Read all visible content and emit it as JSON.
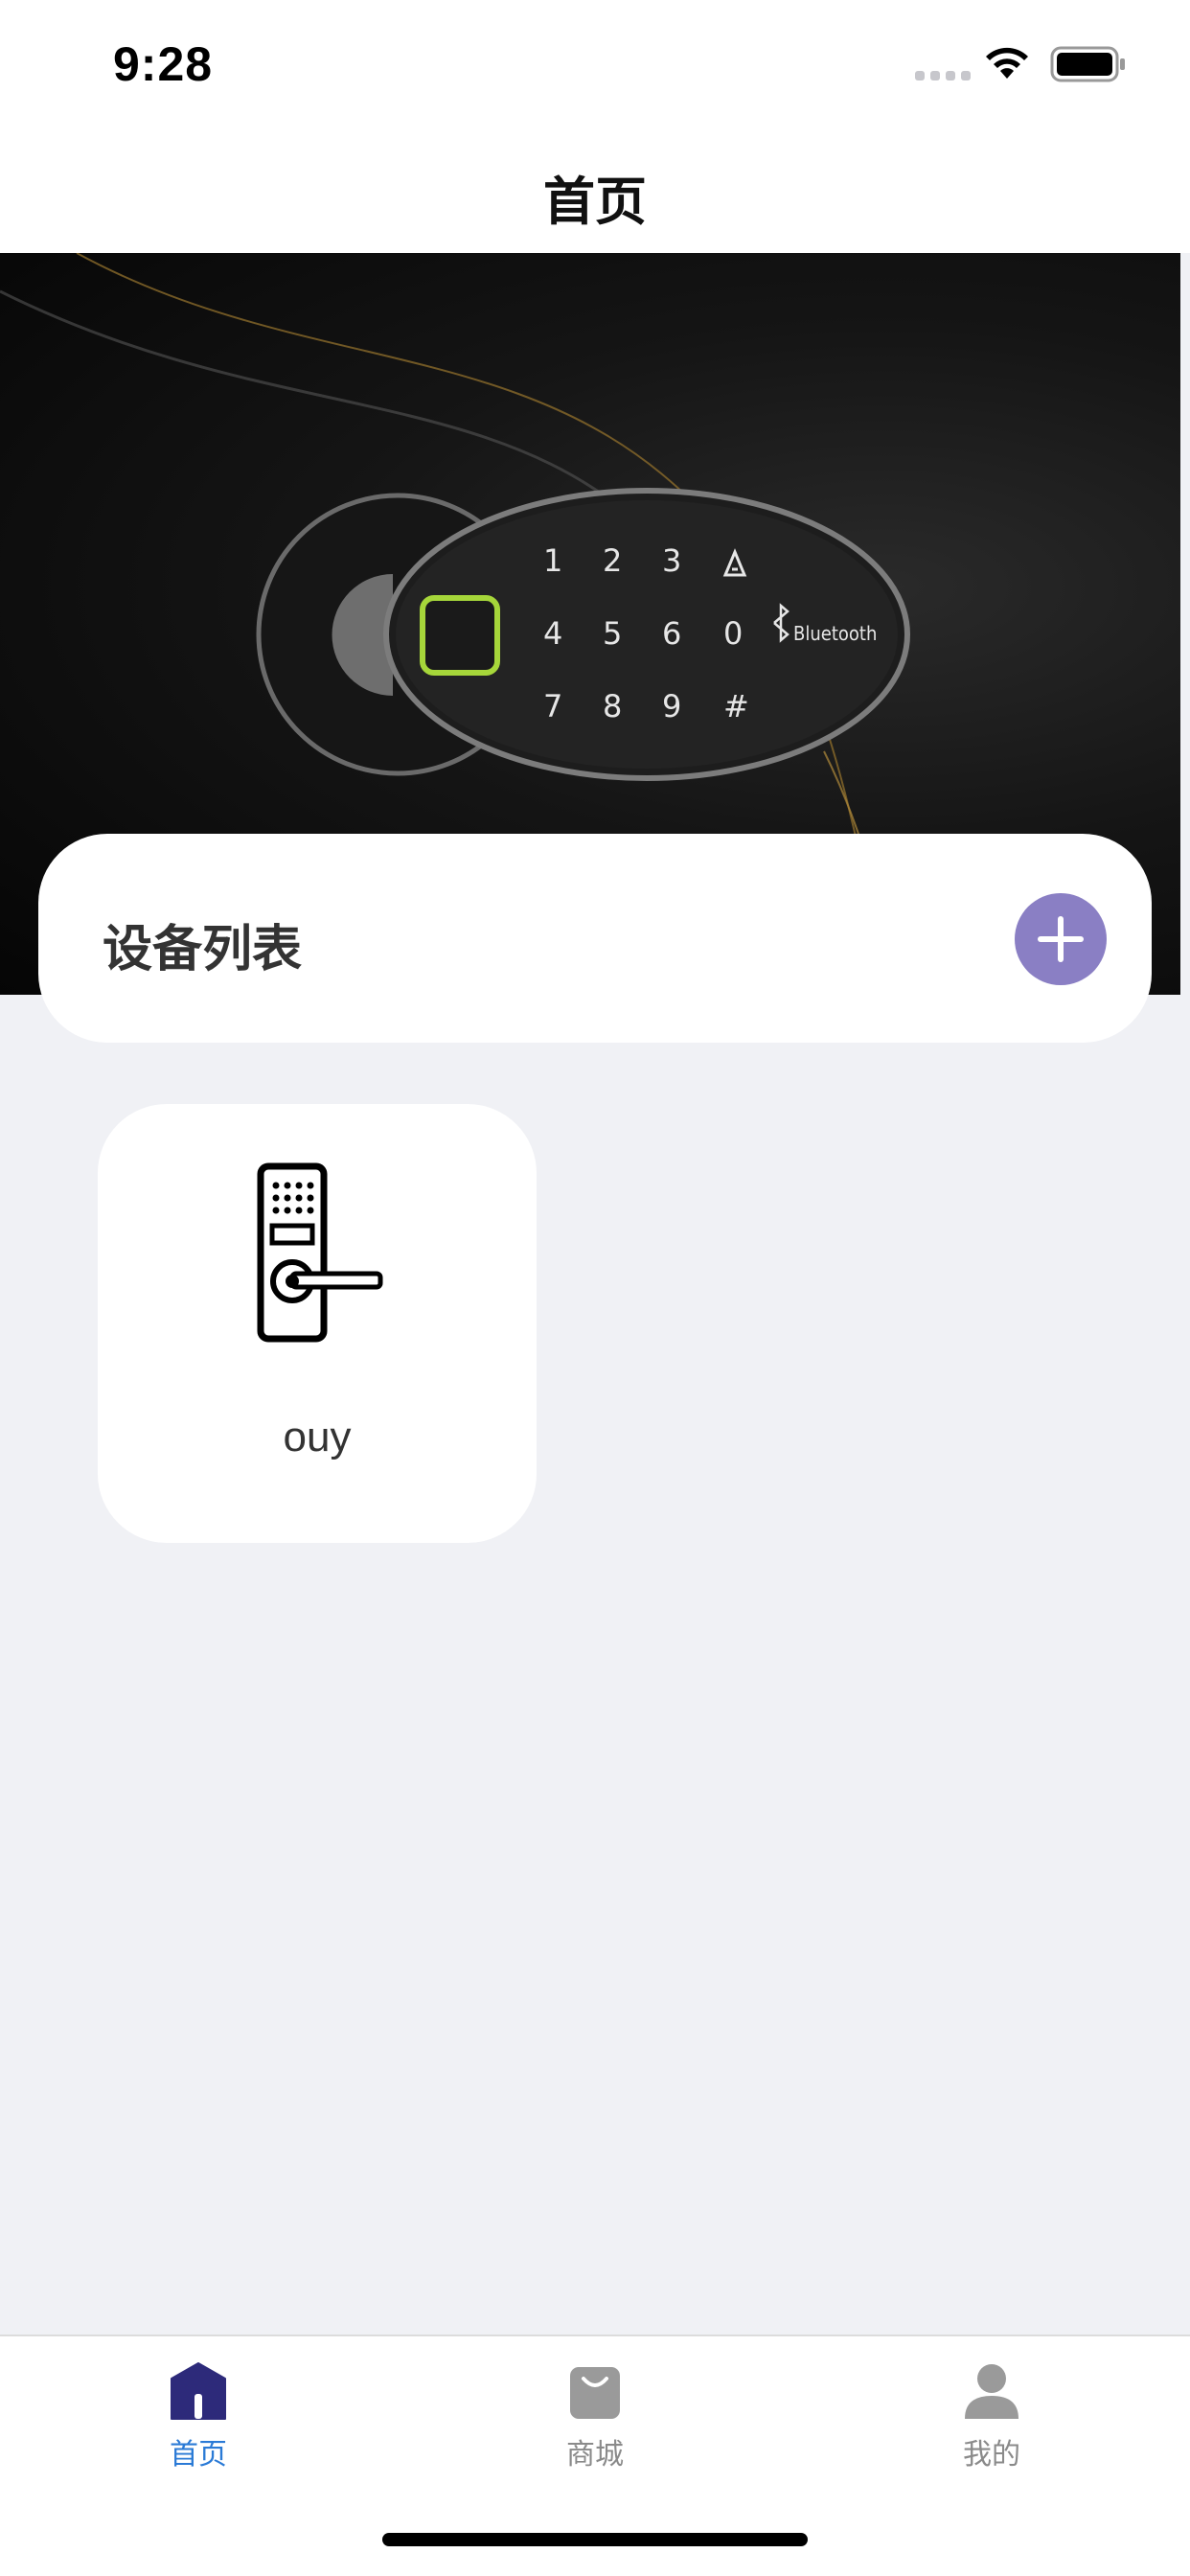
{
  "status_bar": {
    "time": "9:28"
  },
  "nav": {
    "title": "首页"
  },
  "banner": {
    "keypad_rows": [
      [
        "1",
        "2",
        "3",
        "bell-icon"
      ],
      [
        "4",
        "5",
        "6",
        "0",
        "Bluetooth"
      ],
      [
        "7",
        "8",
        "9",
        "#"
      ]
    ]
  },
  "device_list": {
    "title": "设备列表",
    "add_icon": "plus-icon",
    "accent_color": "#8a7fc4"
  },
  "devices": [
    {
      "name": "ouy",
      "icon": "door-lock-icon"
    }
  ],
  "tab_bar": {
    "active_color": "#2a7ad6",
    "inactive_color": "#8a8a8a",
    "tabs": [
      {
        "label": "首页",
        "icon": "home-icon",
        "active": true
      },
      {
        "label": "商城",
        "icon": "shopping-bag-icon",
        "active": false
      },
      {
        "label": "我的",
        "icon": "user-icon",
        "active": false
      }
    ]
  }
}
